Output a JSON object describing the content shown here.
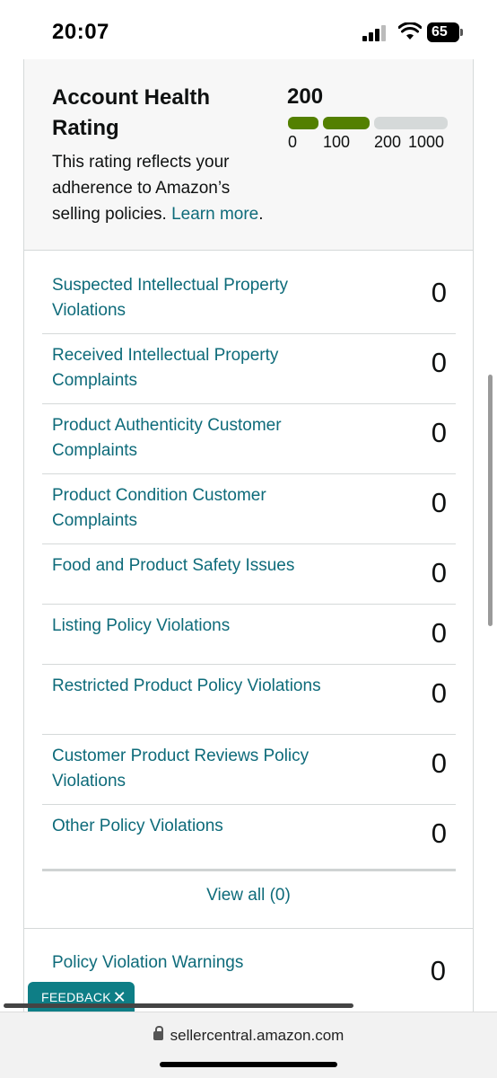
{
  "status_bar": {
    "time": "20:07",
    "battery": "65",
    "icons": [
      "signal-icon",
      "wifi-icon",
      "battery-icon"
    ]
  },
  "health": {
    "title": "Account Health Rating",
    "description": "This rating reflects your adherence to Amazon’s selling policies.",
    "learn_more": "Learn more",
    "score": "200",
    "score_fraction_of_scale": 0.2,
    "scale_labels": [
      "0",
      "100",
      "200",
      "1000"
    ],
    "colors": {
      "good": "#538000",
      "empty": "#d5d9d9",
      "link": "#0e6b7a"
    }
  },
  "metrics": [
    {
      "label": "Suspected Intellectual Property Violations",
      "count": "0"
    },
    {
      "label": "Received Intellectual Property Complaints",
      "count": "0"
    },
    {
      "label": "Product Authenticity Customer Complaints",
      "count": "0"
    },
    {
      "label": "Product Condition Customer Complaints",
      "count": "0"
    },
    {
      "label": "Food and Product Safety Issues",
      "count": "0"
    },
    {
      "label": "Listing Policy Violations",
      "count": "0"
    },
    {
      "label": "Restricted Product Policy Violations",
      "count": "0"
    },
    {
      "label": "Customer Product Reviews Policy Violations",
      "count": "0"
    },
    {
      "label": "Other Policy Violations",
      "count": "0"
    }
  ],
  "view_all": "View all (0)",
  "warnings": {
    "label": "Policy Violation Warnings",
    "count": "0"
  },
  "feedback": {
    "label": "FEEDBACK",
    "close": "✕"
  },
  "browser": {
    "url": "sellercentral.amazon.com",
    "lock_icon": "lock-icon"
  }
}
